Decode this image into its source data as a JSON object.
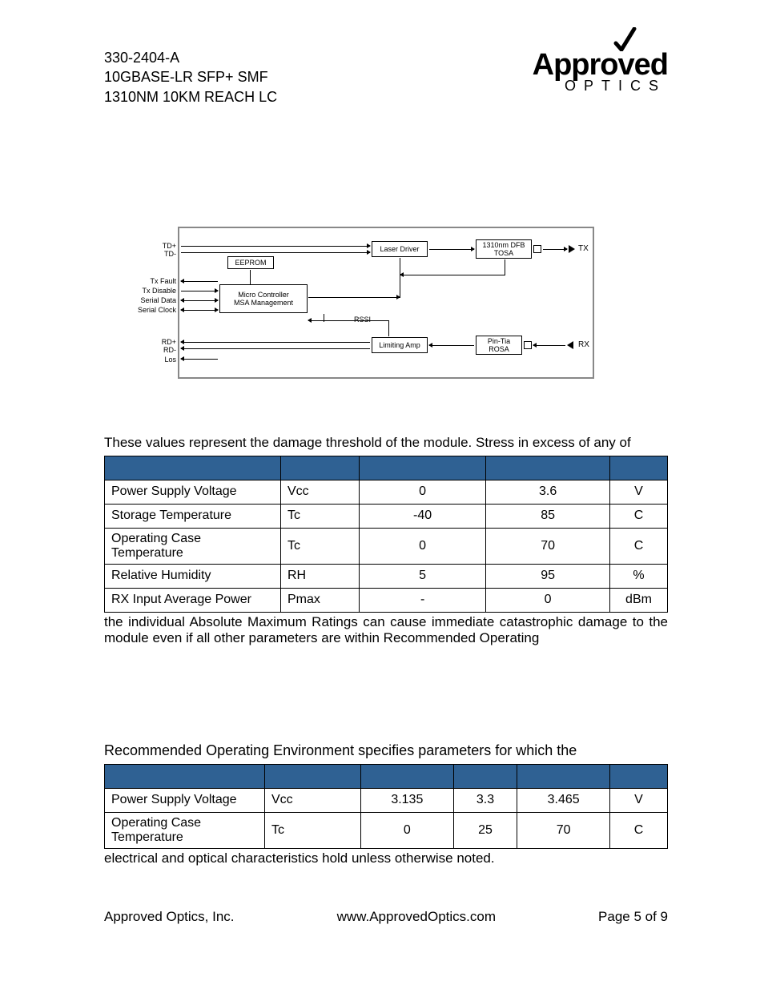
{
  "header": {
    "line1": "330-2404-A",
    "line2": "10GBASE-LR SFP+ SMF",
    "line3": "1310NM 10KM REACH LC",
    "logo_main": "Appro",
    "logo_v": "v",
    "logo_ed": "ed",
    "logo_sub": "OPTICS"
  },
  "diagram": {
    "left_labels": {
      "td": "TD+\nTD-",
      "txfault": "Tx Fault",
      "txdisable": "Tx Disable",
      "serialdata": "Serial Data",
      "serialclock": "Serial Clock",
      "rd": "RD+\nRD-",
      "los": "Los"
    },
    "boxes": {
      "eeprom": "EEPROM",
      "micro": "Micro Controller\nMSA Management",
      "laser_driver": "Laser Driver",
      "tosa": "1310nm DFB\nTOSA",
      "limiting_amp": "Limiting Amp",
      "rosa": "Pin-Tia\nROSA",
      "rssi": "RSSI"
    },
    "right": {
      "tx": "TX",
      "rx": "RX"
    }
  },
  "section1": {
    "intro": "These values represent the damage threshold of the module. Stress in excess of any of",
    "after": "the individual Absolute Maximum Ratings can cause immediate catastrophic damage to the module even if all other parameters are within Recommended Operating",
    "rows": [
      {
        "param": "Power Supply Voltage",
        "sym": "Vcc",
        "min": "0",
        "max": "3.6",
        "unit": "V"
      },
      {
        "param": "Storage Temperature",
        "sym": "Tc",
        "min": "-40",
        "max": "85",
        "unit": "C"
      },
      {
        "param": "Operating Case Temperature",
        "sym": "Tc",
        "min": "0",
        "max": "70",
        "unit": "C"
      },
      {
        "param": "Relative Humidity",
        "sym": "RH",
        "min": "5",
        "max": "95",
        "unit": "%"
      },
      {
        "param": "RX Input Average Power",
        "sym": "Pmax",
        "min": "-",
        "max": "0",
        "unit": "dBm"
      }
    ]
  },
  "section2": {
    "intro": "Recommended Operating Environment specifies parameters for which the",
    "after": "electrical and optical characteristics hold unless otherwise noted.",
    "rows": [
      {
        "param": "Power Supply Voltage",
        "sym": "Vcc",
        "min": "3.135",
        "typ": "3.3",
        "max": "3.465",
        "unit": "V"
      },
      {
        "param": "Operating Case Temperature",
        "sym": "Tc",
        "min": "0",
        "typ": "25",
        "max": "70",
        "unit": "C"
      }
    ]
  },
  "footer": {
    "company": "Approved Optics, Inc.",
    "url": "www.ApprovedOptics.com",
    "page": "Page 5 of 9"
  }
}
